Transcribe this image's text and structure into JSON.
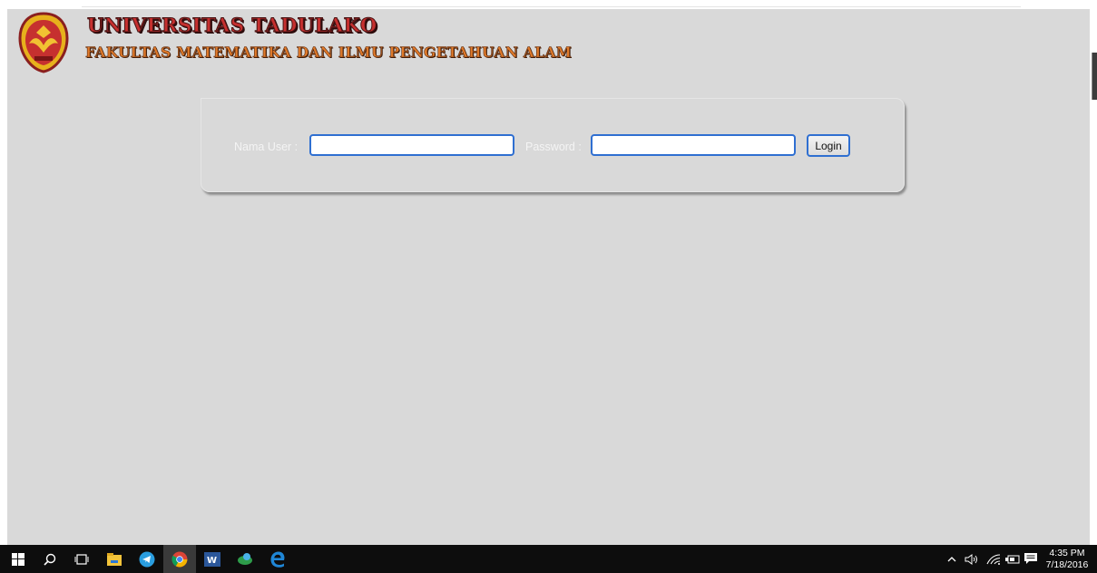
{
  "header": {
    "university": "UNIVERSITAS TADULAKO",
    "faculty": "FAKULTAS MATEMATIKA DAN ILMU PENGETAHUAN ALAM"
  },
  "login": {
    "user_label": "Nama User :",
    "password_label": "Password :",
    "user_value": "",
    "password_value": "",
    "button_label": "Login"
  },
  "taskbar": {
    "items": [
      "windows-start",
      "search",
      "task-view",
      "file-explorer",
      "telegram",
      "chrome",
      "word",
      "network-app",
      "edge"
    ],
    "active": "chrome"
  },
  "tray": {
    "time": "4:35 PM",
    "date": "7/18/2016",
    "icons": [
      "chevron-up-icon",
      "volume-icon",
      "wifi-icon",
      "battery-icon",
      "notification-icon"
    ]
  },
  "colors": {
    "page_bg": "#d9d9d9",
    "title_red": "#c6302f",
    "subtitle_orange": "#e07a2a",
    "focus_blue": "#2f6fd1",
    "taskbar": "#0d0d0d"
  }
}
